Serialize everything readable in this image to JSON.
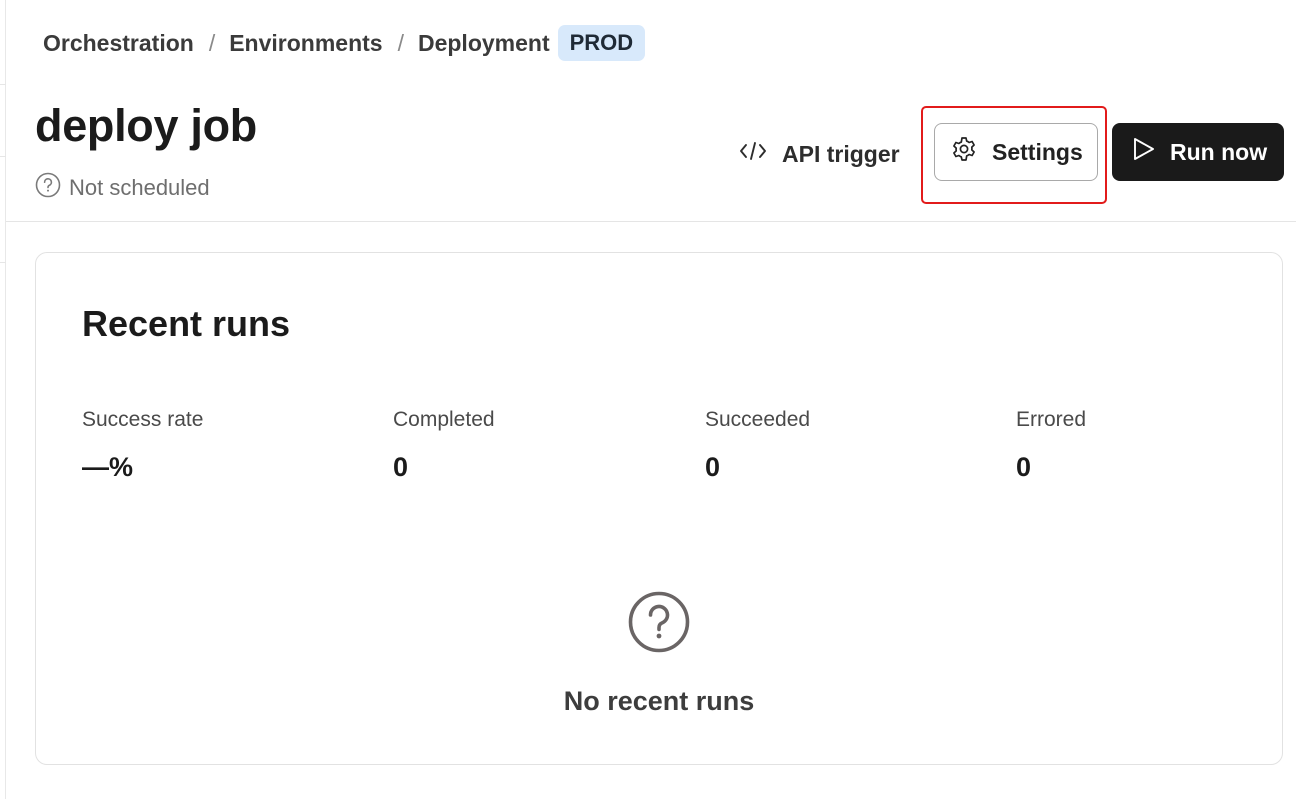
{
  "breadcrumb": {
    "items": [
      "Orchestration",
      "Environments",
      "Deployment"
    ],
    "separator": "/",
    "badge": "PROD"
  },
  "job": {
    "title": "deploy job",
    "schedule_status": "Not scheduled"
  },
  "actions": {
    "api_trigger_label": "API trigger",
    "settings_label": "Settings",
    "run_now_label": "Run now"
  },
  "recent_runs": {
    "title": "Recent runs",
    "stats": [
      {
        "label": "Success rate",
        "value": "—%"
      },
      {
        "label": "Completed",
        "value": "0"
      },
      {
        "label": "Succeeded",
        "value": "0"
      },
      {
        "label": "Errored",
        "value": "0"
      }
    ],
    "empty_message": "No recent runs"
  },
  "icons": {
    "schedule": "question-circle-icon",
    "api_trigger": "code-icon",
    "settings": "gear-icon",
    "run_now": "play-icon",
    "empty_state": "question-circle-icon"
  },
  "colors": {
    "badge_bg": "#d8e9fb",
    "primary_button": "#1a1a1a",
    "focus_outline": "#e21b1b"
  }
}
